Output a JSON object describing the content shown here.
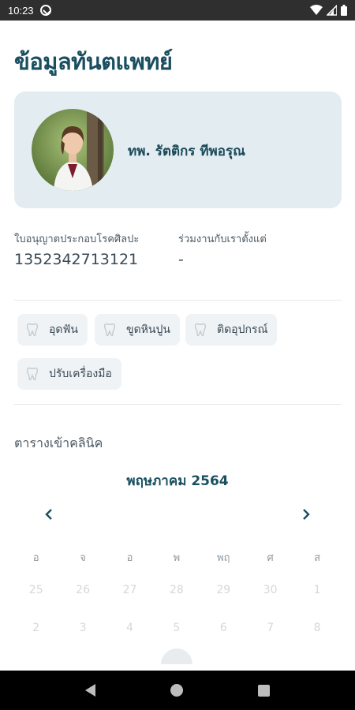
{
  "status_bar": {
    "time": "10:23"
  },
  "page": {
    "title": "ข้อมูลทันตแพทย์"
  },
  "profile": {
    "name": "ทพ. รัตติกร ทีพอรุณ"
  },
  "license": {
    "label": "ใบอนุญาตประกอบโรคศิลปะ",
    "value": "1352342713121"
  },
  "joined": {
    "label": "ร่วมงานกับเราตั้งแต่",
    "value": "-"
  },
  "services": [
    {
      "label": "อุดฟัน",
      "icon": "tooth-icon"
    },
    {
      "label": "ขูดหินปูน",
      "icon": "tooth-icon"
    },
    {
      "label": "ติดอุปกรณ์",
      "icon": "tooth-icon"
    },
    {
      "label": "ปรับเครื่องมือ",
      "icon": "tooth-icon"
    }
  ],
  "schedule": {
    "section_label": "ตารางเข้าคลินิค",
    "month_title": "พฤษภาคม 2564",
    "weekdays": [
      "อ",
      "จ",
      "อ",
      "พ",
      "พฤ",
      "ศ",
      "ส"
    ],
    "weeks": [
      [
        "25",
        "26",
        "27",
        "28",
        "29",
        "30",
        "1"
      ],
      [
        "2",
        "3",
        "4",
        "5",
        "6",
        "7",
        "8"
      ]
    ]
  },
  "colors": {
    "accent": "#1a4f60",
    "card_bg": "#e3edf1",
    "chip_bg": "#f0f3f5"
  }
}
